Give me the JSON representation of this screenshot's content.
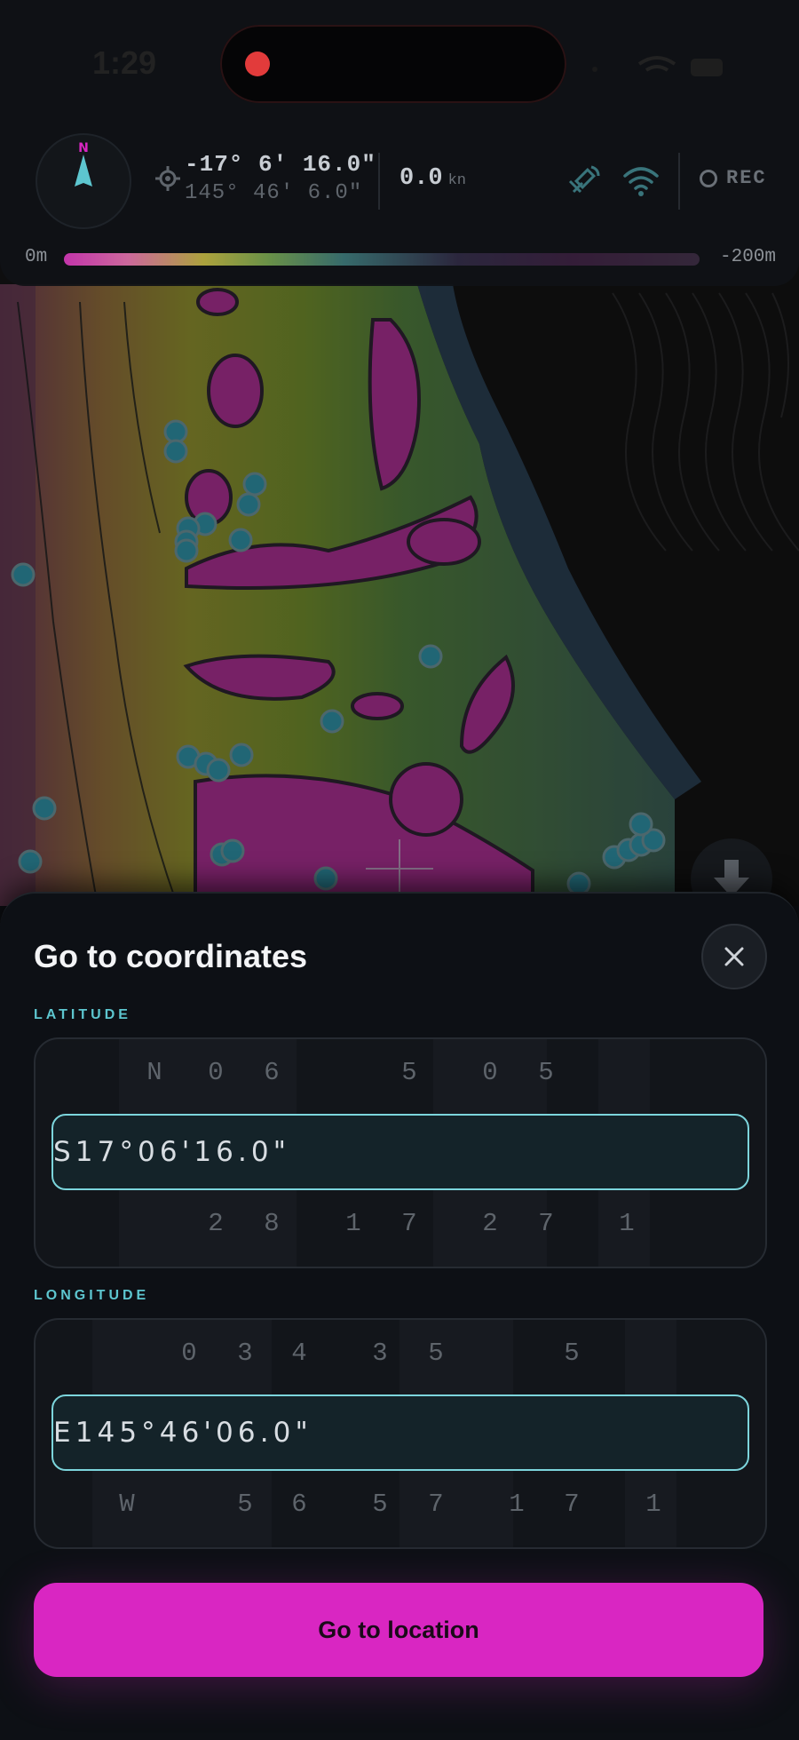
{
  "status_bar": {
    "time": "1:29"
  },
  "top_hud": {
    "compass_heading_label": "N",
    "latitude_display": "-17° 6' 16.0\"",
    "longitude_display": "145° 46' 6.0\"",
    "speed_value": "0.0",
    "speed_unit": "kn",
    "rec_label": "REC",
    "depth_min_label": "0m",
    "depth_max_label": "-200m"
  },
  "sheet": {
    "title": "Go to coordinates",
    "latitude_label": "LATITUDE",
    "longitude_label": "LONGITUDE",
    "latitude_picker": {
      "above": [
        "N",
        "0",
        "6",
        "5",
        "0",
        "5"
      ],
      "selected": [
        "S",
        "1",
        "7",
        "°",
        "0",
        "6",
        "'",
        "1",
        "6",
        ".",
        "0",
        "\""
      ],
      "below": [
        "2",
        "8",
        "1",
        "7",
        "2",
        "7",
        "1"
      ]
    },
    "longitude_picker": {
      "above": [
        "0",
        "3",
        "4",
        "3",
        "5",
        "5"
      ],
      "selected": [
        "E",
        "1",
        "4",
        "5",
        "°",
        "4",
        "6",
        "'",
        "0",
        "6",
        ".",
        "0",
        "\""
      ],
      "below": [
        "W",
        "5",
        "6",
        "5",
        "7",
        "1",
        "7",
        "1"
      ]
    },
    "go_button_label": "Go to location",
    "close_icon": "close-icon"
  },
  "colors": {
    "accent_magenta": "#d926c2",
    "accent_cyan": "#5dc6cf",
    "sheet_background": "#0d1015"
  }
}
